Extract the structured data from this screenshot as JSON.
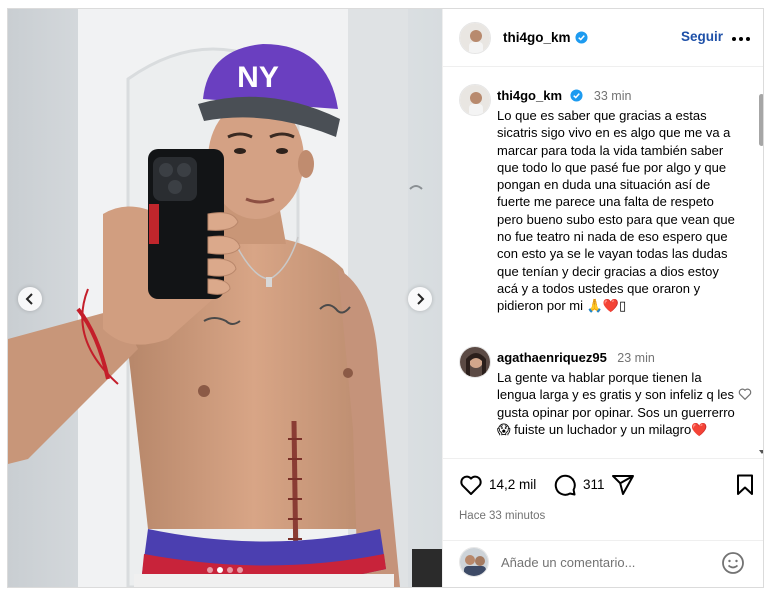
{
  "post": {
    "author": "thi4go_km",
    "follow_label": "Seguir",
    "caption": {
      "username": "thi4go_km",
      "time": "33 min",
      "text": "Lo que es saber que gracias a estas sicatris sigo vivo en es algo que me va a marcar para toda la vida también saber que todo lo que pasé fue por algo y que pongan en duda una situación así de fuerte me parece una falta de respeto pero bueno subo esto para que vean que no fue teatro ni nada de eso espero que con esto ya se le vayan todas las dudas que tenían y decir gracias a dios estoy acá y a todos ustedes que oraron y pidieron por mi 🙏❤️▯"
    },
    "comment": {
      "username": "agathaenriquez95",
      "time": "23 min",
      "text": "La gente va hablar porque tienen la lengua larga y es gratis y son infeliz q les gusta opinar por opinar. Sos un guerrerro😱 fuiste un luchador y un milagro❤️"
    },
    "likes": "14,2 mil",
    "comments_count": "311",
    "posted_ago": "Hace 33 minutos",
    "add_comment_placeholder": "Añade un comentario...",
    "carousel": {
      "total": 4,
      "current": 2
    }
  },
  "icons": {
    "verified": "verified-badge-icon",
    "more": "more-options-icon",
    "like": "heart-icon",
    "comment": "comment-icon",
    "share": "share-icon",
    "save": "bookmark-icon",
    "emoji": "emoji-icon",
    "prev": "chevron-left-icon",
    "next": "chevron-right-icon"
  },
  "colors": {
    "link": "#1e50a8",
    "verified": "#1d9bf0",
    "muted": "#737373",
    "cap": "#6a3fc0"
  }
}
